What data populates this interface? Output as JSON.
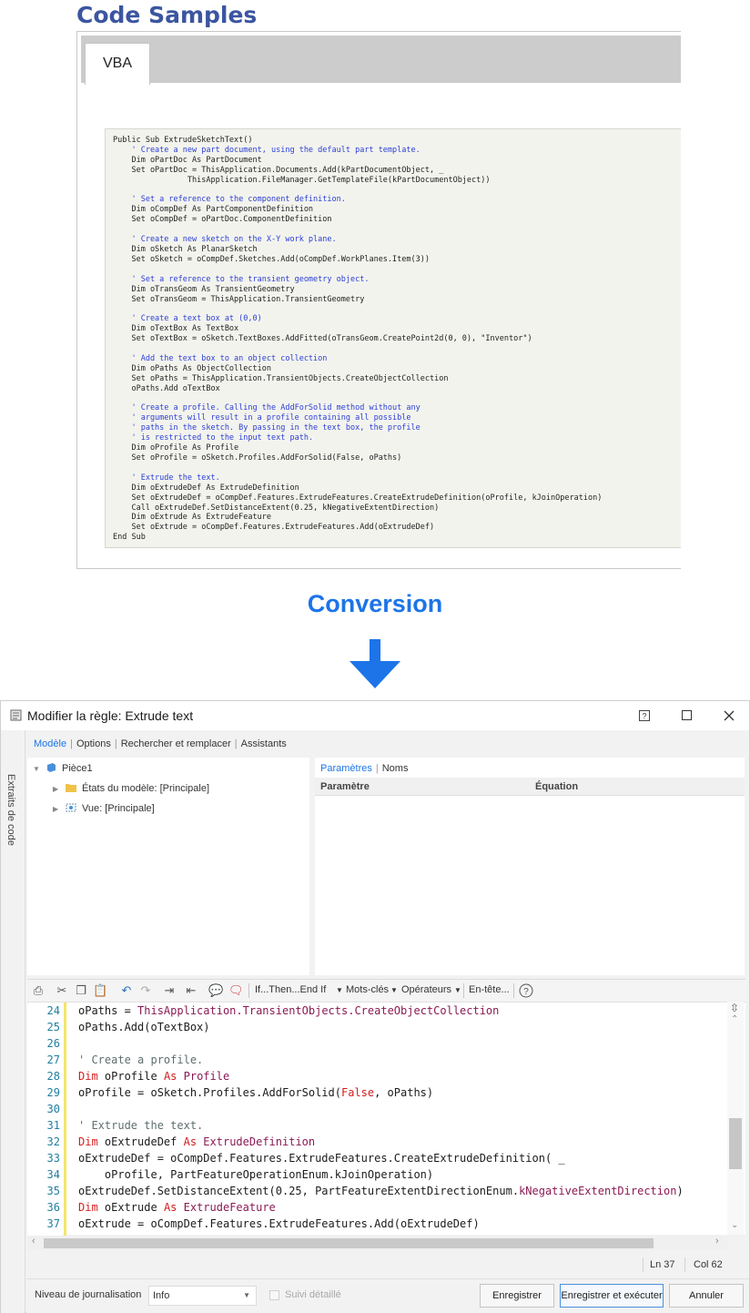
{
  "code_samples": {
    "title": "Code Samples",
    "tab_label": "VBA",
    "lines": [
      {
        "text": "Public Sub ExtrudeSketchText()",
        "type": "code"
      },
      {
        "text": "    ' Create a new part document, using the default part template.",
        "type": "comment"
      },
      {
        "text": "    Dim oPartDoc As PartDocument",
        "type": "code"
      },
      {
        "text": "    Set oPartDoc = ThisApplication.Documents.Add(kPartDocumentObject, _",
        "type": "code"
      },
      {
        "text": "                ThisApplication.FileManager.GetTemplateFile(kPartDocumentObject))",
        "type": "code"
      },
      {
        "text": "",
        "type": "code"
      },
      {
        "text": "    ' Set a reference to the component definition.",
        "type": "comment"
      },
      {
        "text": "    Dim oCompDef As PartComponentDefinition",
        "type": "code"
      },
      {
        "text": "    Set oCompDef = oPartDoc.ComponentDefinition",
        "type": "code"
      },
      {
        "text": "",
        "type": "code"
      },
      {
        "text": "    ' Create a new sketch on the X-Y work plane.",
        "type": "comment"
      },
      {
        "text": "    Dim oSketch As PlanarSketch",
        "type": "code"
      },
      {
        "text": "    Set oSketch = oCompDef.Sketches.Add(oCompDef.WorkPlanes.Item(3))",
        "type": "code"
      },
      {
        "text": "",
        "type": "code"
      },
      {
        "text": "    ' Set a reference to the transient geometry object.",
        "type": "comment"
      },
      {
        "text": "    Dim oTransGeom As TransientGeometry",
        "type": "code"
      },
      {
        "text": "    Set oTransGeom = ThisApplication.TransientGeometry",
        "type": "code"
      },
      {
        "text": "",
        "type": "code"
      },
      {
        "text": "    ' Create a text box at (0,0)",
        "type": "comment"
      },
      {
        "text": "    Dim oTextBox As TextBox",
        "type": "code"
      },
      {
        "text": "    Set oTextBox = oSketch.TextBoxes.AddFitted(oTransGeom.CreatePoint2d(0, 0), \"Inventor\")",
        "type": "code"
      },
      {
        "text": "",
        "type": "code"
      },
      {
        "text": "    ' Add the text box to an object collection",
        "type": "comment"
      },
      {
        "text": "    Dim oPaths As ObjectCollection",
        "type": "code"
      },
      {
        "text": "    Set oPaths = ThisApplication.TransientObjects.CreateObjectCollection",
        "type": "code"
      },
      {
        "text": "    oPaths.Add oTextBox",
        "type": "code"
      },
      {
        "text": "",
        "type": "code"
      },
      {
        "text": "    ' Create a profile. Calling the AddForSolid method without any",
        "type": "comment"
      },
      {
        "text": "    ' arguments will result in a profile containing all possible",
        "type": "comment"
      },
      {
        "text": "    ' paths in the sketch. By passing in the text box, the profile",
        "type": "comment"
      },
      {
        "text": "    ' is restricted to the input text path.",
        "type": "comment"
      },
      {
        "text": "    Dim oProfile As Profile",
        "type": "code"
      },
      {
        "text": "    Set oProfile = oSketch.Profiles.AddForSolid(False, oPaths)",
        "type": "code"
      },
      {
        "text": "",
        "type": "code"
      },
      {
        "text": "    ' Extrude the text.",
        "type": "comment"
      },
      {
        "text": "    Dim oExtrudeDef As ExtrudeDefinition",
        "type": "code"
      },
      {
        "text": "    Set oExtrudeDef = oCompDef.Features.ExtrudeFeatures.CreateExtrudeDefinition(oProfile, kJoinOperation)",
        "type": "code"
      },
      {
        "text": "    Call oExtrudeDef.SetDistanceExtent(0.25, kNegativeExtentDirection)",
        "type": "code"
      },
      {
        "text": "    Dim oExtrude As ExtrudeFeature",
        "type": "code"
      },
      {
        "text": "    Set oExtrude = oCompDef.Features.ExtrudeFeatures.Add(oExtrudeDef)",
        "type": "code"
      },
      {
        "text": "End Sub",
        "type": "code"
      }
    ]
  },
  "conversion": {
    "label": "Conversion",
    "arrow_color": "#1c74e8"
  },
  "dialog": {
    "title": "Modifier la règle: Extrude text",
    "title_icon": "scroll-icon",
    "window_buttons": {
      "help": "?",
      "maximize": "□",
      "close": "✕"
    },
    "side_label": "Extraits de code",
    "menu": [
      "Modèle",
      "Options",
      "Rechercher et remplacer",
      "Assistants"
    ],
    "tree": {
      "root": "Pièce1",
      "children": [
        "États du modèle: [Principale]",
        "Vue: [Principale]"
      ]
    },
    "params": {
      "tabs": [
        "Paramètres",
        "Noms"
      ],
      "columns": [
        "Paramètre",
        "Équation"
      ]
    },
    "toolbar": {
      "ifthen": "If...Then...End If",
      "keywords": "Mots-clés",
      "operators": "Opérateurs",
      "header": "En-tête..."
    },
    "editor": {
      "lines": [
        {
          "n": "24",
          "tokens": [
            [
              "id",
              "oPaths = "
            ],
            [
              "obj",
              "ThisApplication.TransientObjects.CreateObjectCollection"
            ]
          ]
        },
        {
          "n": "25",
          "tokens": [
            [
              "id",
              "oPaths.Add(oTextBox)"
            ]
          ]
        },
        {
          "n": "26",
          "tokens": []
        },
        {
          "n": "27",
          "tokens": [
            [
              "cm",
              "' Create a profile."
            ]
          ]
        },
        {
          "n": "28",
          "tokens": [
            [
              "kw",
              "Dim "
            ],
            [
              "id",
              "oProfile "
            ],
            [
              "kw",
              "As "
            ],
            [
              "obj",
              "Profile"
            ]
          ]
        },
        {
          "n": "29",
          "tokens": [
            [
              "id",
              "oProfile = oSketch.Profiles.AddForSolid("
            ],
            [
              "kw",
              "False"
            ],
            [
              "id",
              ", oPaths)"
            ]
          ]
        },
        {
          "n": "30",
          "tokens": []
        },
        {
          "n": "31",
          "tokens": [
            [
              "cm",
              "' Extrude the text."
            ]
          ]
        },
        {
          "n": "32",
          "tokens": [
            [
              "kw",
              "Dim "
            ],
            [
              "id",
              "oExtrudeDef "
            ],
            [
              "kw",
              "As "
            ],
            [
              "obj",
              "ExtrudeDefinition"
            ]
          ]
        },
        {
          "n": "33",
          "tokens": [
            [
              "id",
              "oExtrudeDef = oCompDef.Features.ExtrudeFeatures.CreateExtrudeDefinition( _"
            ]
          ]
        },
        {
          "n": "34",
          "tokens": [
            [
              "id",
              "    oProfile, PartFeatureOperationEnum.kJoinOperation)"
            ]
          ]
        },
        {
          "n": "35",
          "tokens": [
            [
              "id",
              "oExtrudeDef.SetDistanceExtent(0.25, PartFeatureExtentDirectionEnum."
            ],
            [
              "obj",
              "kNegativeExtentDirection"
            ],
            [
              "id",
              ")"
            ]
          ]
        },
        {
          "n": "36",
          "tokens": [
            [
              "kw",
              "Dim "
            ],
            [
              "id",
              "oExtrude "
            ],
            [
              "kw",
              "As "
            ],
            [
              "obj",
              "ExtrudeFeature"
            ]
          ]
        },
        {
          "n": "37",
          "tokens": [
            [
              "id",
              "oExtrude = oCompDef.Features.ExtrudeFeatures.Add(oExtrudeDef)"
            ]
          ]
        }
      ]
    },
    "status": {
      "ln": "Ln 37",
      "col": "Col 62"
    },
    "bottom": {
      "log_label": "Niveau de journalisation",
      "log_value": "Info",
      "detail_label": "Suivi détaillé",
      "save": "Enregistrer",
      "save_run": "Enregistrer et exécuter",
      "cancel": "Annuler"
    }
  }
}
